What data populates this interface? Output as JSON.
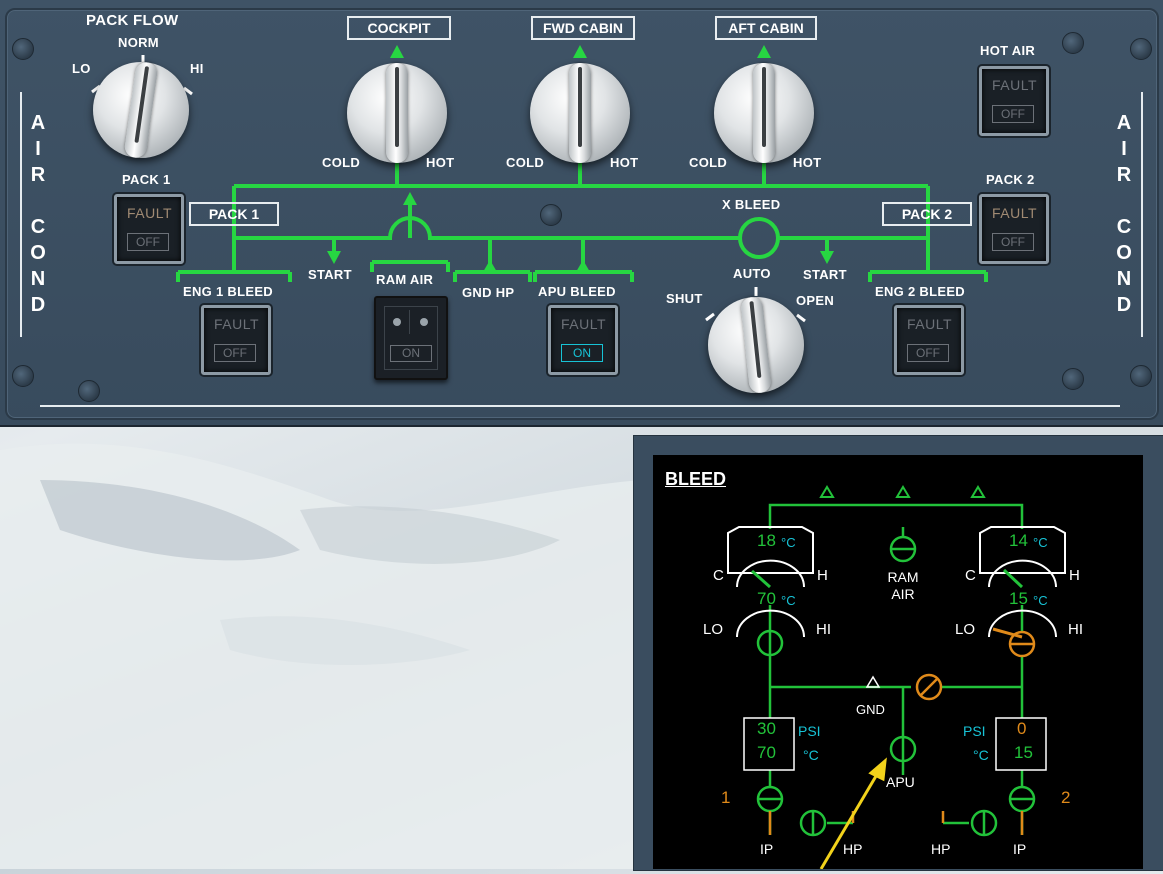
{
  "colors": {
    "panel": "#3f5366",
    "duct_green": "#27d642",
    "ecam_green": "#22c23a",
    "ecam_cyan": "#17c3d6",
    "ecam_amber": "#e08a1a",
    "pointer_yellow": "#f2d21b"
  },
  "panel": {
    "pack_flow": {
      "title": "PACK FLOW",
      "lo": "LO",
      "norm": "NORM",
      "hi": "HI"
    },
    "zones": [
      {
        "label": "COCKPIT",
        "cold": "COLD",
        "hot": "HOT"
      },
      {
        "label": "FWD CABIN",
        "cold": "COLD",
        "hot": "HOT"
      },
      {
        "label": "AFT CABIN",
        "cold": "COLD",
        "hot": "HOT"
      }
    ],
    "hot_air": {
      "label": "HOT AIR",
      "fault": "FAULT",
      "off": "OFF"
    },
    "pack1": {
      "label": "PACK 1",
      "box_label": "PACK 1",
      "fault": "FAULT",
      "off": "OFF"
    },
    "pack2": {
      "label": "PACK 2",
      "box_label": "PACK 2",
      "fault": "FAULT",
      "off": "OFF"
    },
    "x_bleed": {
      "label": "X BLEED",
      "shut": "SHUT",
      "auto": "AUTO",
      "open": "OPEN"
    },
    "start_left": "START",
    "start_right": "START",
    "ram_air": {
      "label": "RAM AIR",
      "on": "ON"
    },
    "gnd_hp": "GND HP",
    "eng1_bleed": {
      "label": "ENG 1 BLEED",
      "fault": "FAULT",
      "off": "OFF"
    },
    "apu_bleed": {
      "label": "APU BLEED",
      "fault": "FAULT",
      "on": "ON"
    },
    "eng2_bleed": {
      "label": "ENG 2 BLEED",
      "fault": "FAULT",
      "off": "OFF"
    },
    "side_left": [
      "A",
      "I",
      "R",
      "",
      "C",
      "O",
      "N",
      "D"
    ],
    "side_right": [
      "A",
      "I",
      "R",
      "",
      "C",
      "O",
      "N",
      "D"
    ]
  },
  "ecam": {
    "title": "BLEED",
    "pack1": {
      "temp_out": "18",
      "temp_unit": "°C",
      "c": "C",
      "h": "H",
      "temp_in": "70",
      "lo": "LO",
      "hi": "HI"
    },
    "pack2": {
      "temp_out": "14",
      "temp_unit": "°C",
      "c": "C",
      "h": "H",
      "temp_in": "15",
      "lo": "LO",
      "hi": "HI"
    },
    "ram_air": [
      "RAM",
      "AIR"
    ],
    "gnd": "GND",
    "apu": "APU",
    "eng1": {
      "psi": "30",
      "temp": "70",
      "num": "1"
    },
    "eng2": {
      "psi": "0",
      "temp": "15",
      "num": "2"
    },
    "psi_label": "PSI",
    "degc_label": "°C",
    "ip": "IP",
    "hp": "HP"
  }
}
